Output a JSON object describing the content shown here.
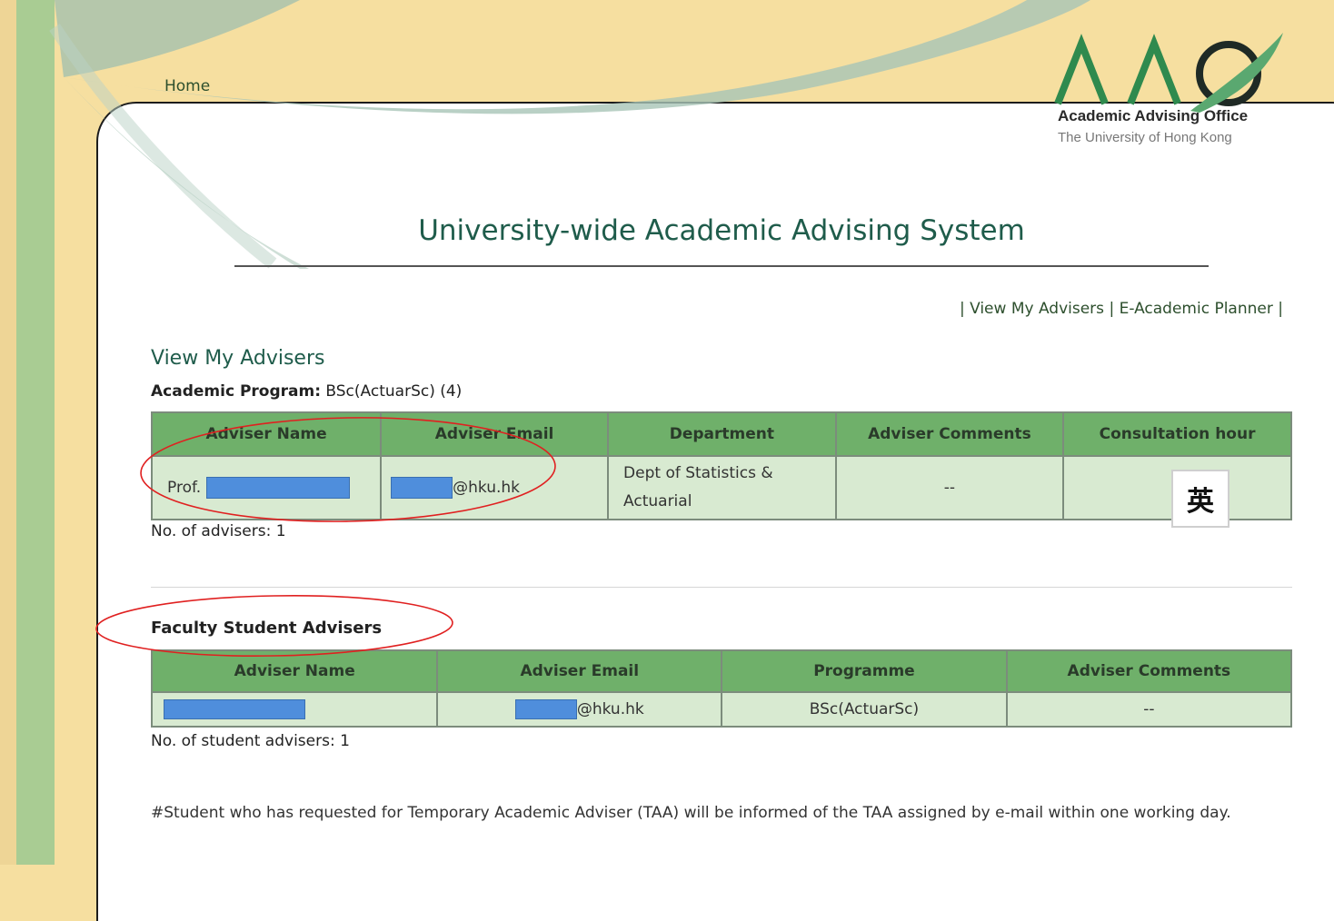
{
  "nav": {
    "home": "Home"
  },
  "logo": {
    "letters": "AAO",
    "title": "Academic Advising Office",
    "subtitle": "The University of Hong Kong"
  },
  "page_title": "University-wide Academic Advising System",
  "topnav": {
    "sep": "|",
    "view_advisers": "View My Advisers",
    "planner": "E-Academic Planner"
  },
  "section": {
    "heading": "View My Advisers",
    "program_label": "Academic Program:",
    "program_value": "BSc(ActuarSc) (4)"
  },
  "advisers_table": {
    "headers": [
      "Adviser Name",
      "Adviser Email",
      "Department",
      "Adviser Comments",
      "Consultation hour"
    ],
    "row": {
      "name_prefix": "Prof.",
      "email_suffix": "@hku.hk",
      "department": "Dept of Statistics & Actuarial",
      "comments": "--",
      "consultation": ""
    },
    "count_text": "No. of advisers: 1"
  },
  "student_advisers": {
    "heading": "Faculty Student Advisers",
    "headers": [
      "Adviser Name",
      "Adviser Email",
      "Programme",
      "Adviser Comments"
    ],
    "row": {
      "email_suffix": "@hku.hk",
      "programme": "BSc(ActuarSc)",
      "comments": "--"
    },
    "count_text": "No. of student advisers: 1"
  },
  "note": "#Student who has requested for Temporary Academic Adviser (TAA) will be informed of the TAA assigned by e-mail within one working day.",
  "ime_indicator": "英",
  "colors": {
    "background": "#f6dfa0",
    "left_band": "#a9cc93",
    "header_green": "#6fb06a",
    "row_green": "#d8ead1",
    "title_teal": "#1f5c4b",
    "annotation_red": "#e02020",
    "redaction_blue": "#4f8edc"
  }
}
